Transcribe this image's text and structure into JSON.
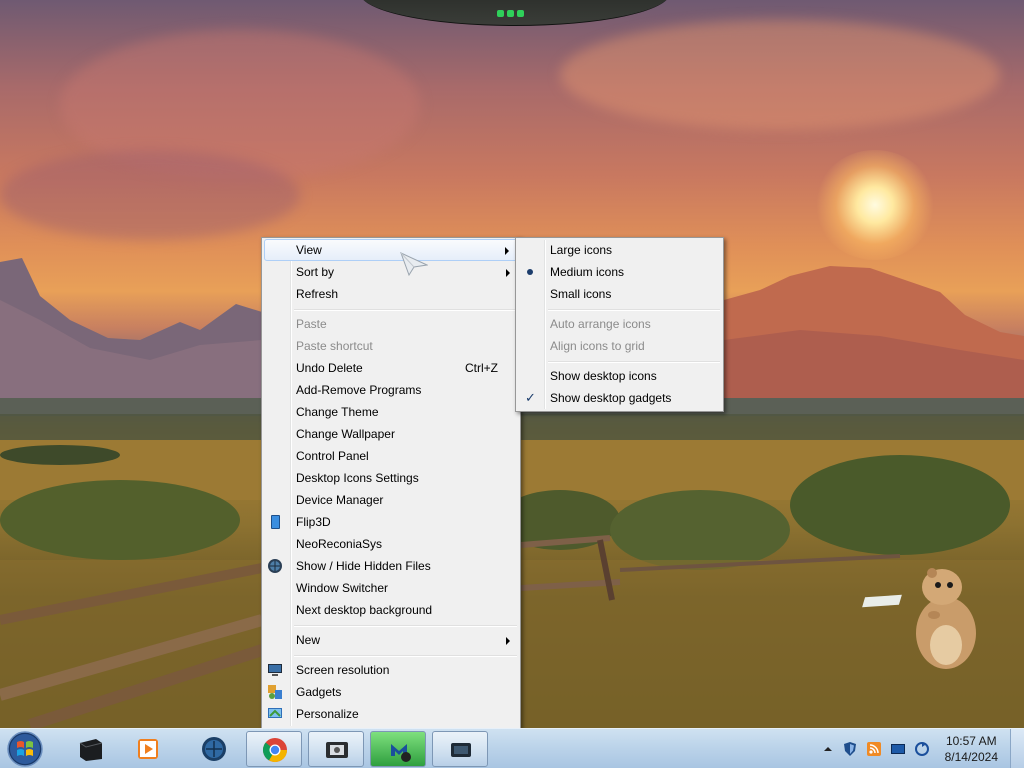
{
  "context_menu": {
    "items": [
      {
        "label": "View",
        "submenu": true
      },
      {
        "label": "Sort by",
        "submenu": true
      },
      {
        "label": "Refresh"
      },
      {
        "label": "Paste",
        "disabled": true
      },
      {
        "label": "Paste shortcut",
        "disabled": true
      },
      {
        "label": "Undo Delete",
        "shortcut": "Ctrl+Z"
      },
      {
        "label": "Add-Remove Programs"
      },
      {
        "label": "Change Theme"
      },
      {
        "label": "Change Wallpaper"
      },
      {
        "label": "Control Panel"
      },
      {
        "label": "Desktop Icons Settings"
      },
      {
        "label": "Device Manager"
      },
      {
        "label": "Flip3D",
        "icon": "flip3d-icon"
      },
      {
        "label": "NeoReconiaSys"
      },
      {
        "label": "Show / Hide Hidden Files",
        "icon": "globe-icon"
      },
      {
        "label": "Window Switcher"
      },
      {
        "label": "Next desktop background"
      },
      {
        "label": "New",
        "submenu": true
      },
      {
        "label": "Screen resolution",
        "icon": "monitor-icon"
      },
      {
        "label": "Gadgets",
        "icon": "gadgets-icon"
      },
      {
        "label": "Personalize",
        "icon": "personalize-icon"
      }
    ]
  },
  "view_submenu": {
    "items": [
      {
        "label": "Large icons"
      },
      {
        "label": "Medium icons",
        "selected": true
      },
      {
        "label": "Small icons"
      },
      {
        "label": "Auto arrange icons",
        "disabled": true
      },
      {
        "label": "Align icons to grid",
        "disabled": true
      },
      {
        "label": "Show desktop icons"
      },
      {
        "label": "Show desktop gadgets",
        "checked": true
      }
    ]
  },
  "taskbar": {
    "start_icon": "windows-start-orb-icon",
    "pinned": [
      "monitor-app-icon",
      "media-player-icon",
      "globe-app-icon",
      "chrome-icon",
      "film-strip-icon",
      "malwarebytes-icon",
      "screen-capture-icon"
    ],
    "tray_icons": [
      "show-hidden-icons-arrow",
      "shield-icon",
      "network-icon",
      "display-icon",
      "sync-icon"
    ],
    "clock": {
      "time": "10:57 AM",
      "date": "8/14/2024"
    }
  },
  "colors": {
    "menu_bg": "#f0f0f0",
    "menu_hover": "#e6eefa",
    "menu_hover_border": "#aecff7",
    "disabled_text": "#8b8b8b",
    "taskbar": "#bcd4ea"
  }
}
